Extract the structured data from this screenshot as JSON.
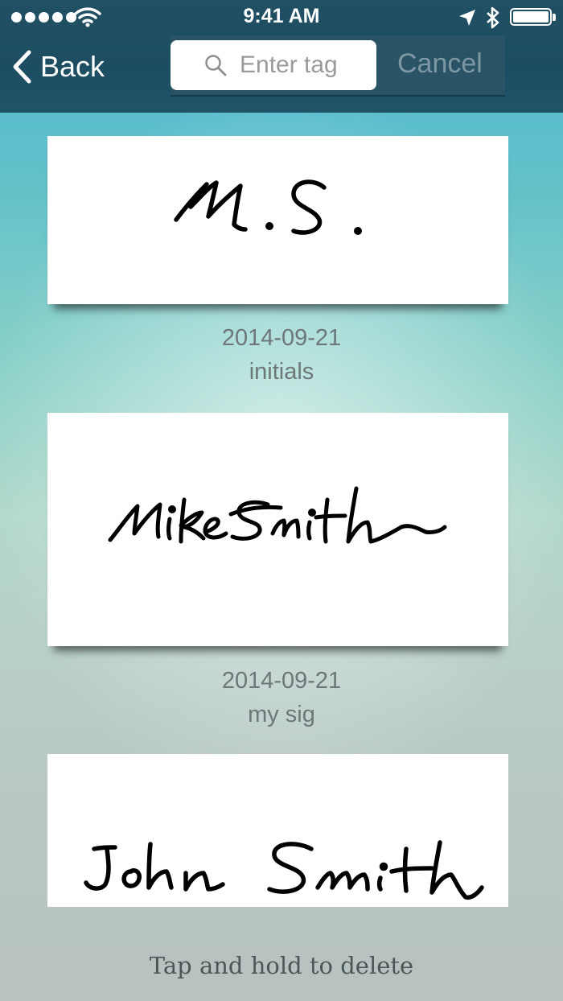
{
  "status_bar": {
    "time": "9:41 AM",
    "signal_icon": "signal-dots-icon",
    "wifi_icon": "wifi-icon",
    "location_icon": "location-arrow-icon",
    "bluetooth_icon": "bluetooth-icon",
    "battery_icon": "battery-icon",
    "battery_level": 1.0
  },
  "nav": {
    "back_label": "Back",
    "search_placeholder": "Enter tag",
    "cancel_label": "Cancel"
  },
  "signatures": [
    {
      "date": "2014-09-21",
      "tag": "initials",
      "signature_text": "M.S."
    },
    {
      "date": "2014-09-21",
      "tag": "my sig",
      "signature_text": "Mike Smith"
    },
    {
      "date": "",
      "tag": "",
      "signature_text": "John Smith"
    }
  ],
  "hint": "Tap and hold to delete",
  "colors": {
    "nav_bar": "#1d4d62",
    "cancel_text": "#7d97a3",
    "meta_text": "#6d7777",
    "hint_text": "#4b5656"
  }
}
